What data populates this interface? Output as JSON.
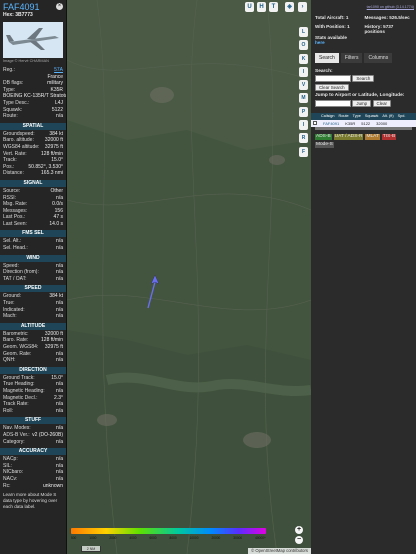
{
  "aircraft": {
    "callsign": "FAF4091",
    "hex_label": "Hex:",
    "hex": "3B7773",
    "photo_credit": "Image © Hervé CHARMAN",
    "fields": [
      {
        "k": "Reg.:",
        "v": "57A",
        "link": true
      },
      {
        "k": "",
        "v": "France"
      },
      {
        "k": "DB flags:",
        "v": "military"
      },
      {
        "k": "Type:",
        "v": "K35R"
      },
      {
        "k": "",
        "v": "BOEING KC-135R/T Stratotanker"
      },
      {
        "k": "Type Desc.:",
        "v": "L4J"
      },
      {
        "k": "Squawk:",
        "v": "5122"
      },
      {
        "k": "Route:",
        "v": "n/a"
      }
    ]
  },
  "sections": [
    {
      "title": "SPATIAL",
      "rows": [
        {
          "k": "Groundspeed:",
          "v": "384 kt"
        },
        {
          "k": "Baro. altitude:",
          "v": "32000 ft"
        },
        {
          "k": "WGS84 altitude:",
          "v": "32975 ft"
        },
        {
          "k": "Vert. Rate:",
          "v": "128 ft/min"
        },
        {
          "k": "Track:",
          "v": "15.0°"
        },
        {
          "k": "Pos.:",
          "v": "50.852°, 3.530°"
        },
        {
          "k": "Distance:",
          "v": "165.3 nmi"
        }
      ]
    },
    {
      "title": "SIGNAL",
      "rows": [
        {
          "k": "Source:",
          "v": "Other"
        },
        {
          "k": "RSSI:",
          "v": "n/a"
        },
        {
          "k": "Msg. Rate:",
          "v": "0.0/s"
        },
        {
          "k": "Messages:",
          "v": "156"
        },
        {
          "k": "Last Pos.:",
          "v": "47 s"
        },
        {
          "k": "Last Seen:",
          "v": "14.0 s"
        }
      ]
    },
    {
      "title": "FMS SEL",
      "rows": [
        {
          "k": "Sel. Alt.:",
          "v": "n/a"
        },
        {
          "k": "Sel. Head.:",
          "v": "n/a"
        }
      ]
    },
    {
      "title": "WIND",
      "rows": [
        {
          "k": "Speed:",
          "v": "n/a"
        },
        {
          "k": "Direction (from):",
          "v": "n/a"
        },
        {
          "k": "TAT / OAT:",
          "v": "n/a"
        }
      ]
    },
    {
      "title": "SPEED",
      "rows": [
        {
          "k": "Ground:",
          "v": "384 kt"
        },
        {
          "k": "True:",
          "v": "n/a"
        },
        {
          "k": "Indicated:",
          "v": "n/a"
        },
        {
          "k": "Mach:",
          "v": "n/a"
        }
      ]
    },
    {
      "title": "ALTITUDE",
      "rows": [
        {
          "k": "Barometric:",
          "v": "32000 ft"
        },
        {
          "k": "Baro. Rate:",
          "v": "128 ft/min"
        },
        {
          "k": "Geom. WGS84:",
          "v": "32975 ft"
        },
        {
          "k": "Geom. Rate:",
          "v": "n/a"
        },
        {
          "k": "QNH:",
          "v": "n/a"
        }
      ]
    },
    {
      "title": "DIRECTION",
      "rows": [
        {
          "k": "Ground Track:",
          "v": "15.0°"
        },
        {
          "k": "True Heading:",
          "v": "n/a"
        },
        {
          "k": "Magnetic Heading:",
          "v": "n/a"
        },
        {
          "k": "Magnetic Decl.:",
          "v": "2.3°"
        },
        {
          "k": "Track Rate:",
          "v": "n/a"
        },
        {
          "k": "Roll:",
          "v": "n/a"
        }
      ]
    },
    {
      "title": "STUFF",
      "rows": [
        {
          "k": "Nav. Modes:",
          "v": "n/a"
        },
        {
          "k": "ADS-B Ver.:",
          "v": "v2 (DO-260B)"
        },
        {
          "k": "Category:",
          "v": "n/a"
        }
      ]
    },
    {
      "title": "ACCURACY",
      "rows": [
        {
          "k": "NACp:",
          "v": "n/a"
        },
        {
          "k": "SIL:",
          "v": "n/a"
        },
        {
          "k": "NICbaro:",
          "v": "n/a"
        },
        {
          "k": "NACv:",
          "v": "n/a"
        },
        {
          "k": "Rc:",
          "v": "unknown"
        }
      ]
    }
  ],
  "learn_more": "Learn more about Mode S data type by hovering over each data label.",
  "map": {
    "top_buttons": [
      "U",
      "H",
      "T"
    ],
    "side_buttons": [
      "L",
      "O",
      "K",
      "I",
      "V",
      "M",
      "P",
      "I",
      "R",
      "F"
    ],
    "zoom_in": "+",
    "zoom_out": "−",
    "scale_label": "2 NM",
    "attribution": "© OpenStreetMap contributors",
    "altitude_labels": [
      "500",
      "1000",
      "2000",
      "4000",
      "6000",
      "8000",
      "10000",
      "20000",
      "30000",
      "40000+"
    ],
    "aircraft_color": "#6a6ef0"
  },
  "right": {
    "version": "tar1090 on github (3.14.1774)",
    "stats": {
      "total_label": "Total Aircraft:",
      "total": "1",
      "messages_label": "Messages:",
      "messages": "526.5/sec",
      "with_pos_label": "With Position:",
      "with_pos": "1",
      "history_label": "History:",
      "history": "5737 positions",
      "stats_label": "Stats available",
      "stats_link": "here"
    },
    "tabs": [
      "Search",
      "Filters",
      "Columns"
    ],
    "search": {
      "label": "Search:",
      "button": "Search",
      "clear_button": "Clear Search",
      "jump_label": "Jump to Airport or Latitude, Longitude:",
      "jump_button": "Jump",
      "clear2_button": "Clear"
    },
    "table_headers": [
      "Callsign",
      "Route",
      "Type",
      "Squawk",
      "Alt. (ft)",
      "Spd."
    ],
    "table_row": {
      "callsign": "FAF4091",
      "type": "K35R",
      "squawk": "5122",
      "alt": "32000"
    },
    "source_filters": [
      {
        "label": "ADS-B",
        "color": "#2e7d32"
      },
      {
        "label": "UAT / ADS-R",
        "color": "#7b7b2e"
      },
      {
        "label": "MLAT",
        "color": "#b07a30"
      },
      {
        "label": "TIS-B",
        "color": "#b03030"
      },
      {
        "label": "Mode-S",
        "color": "#555555"
      }
    ]
  }
}
